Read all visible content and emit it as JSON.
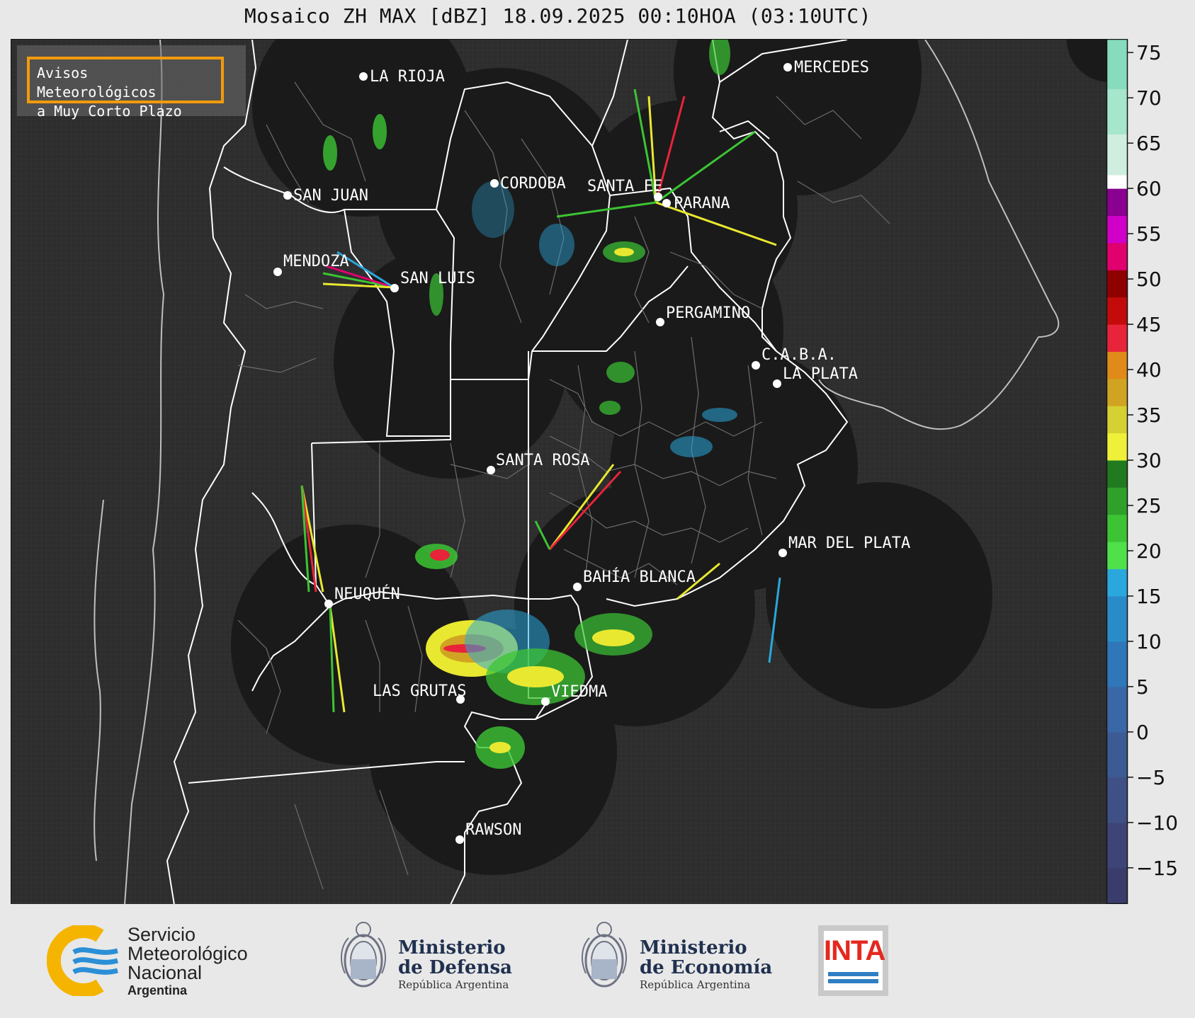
{
  "map": {
    "title": "Mosaico ZH MAX [dBZ] 18.09.2025 00:10HOA (03:10UTC)",
    "notice_line1": "Avisos Meteorológicos",
    "notice_line2": "a Muy Corto Plazo",
    "cities": [
      {
        "name": "LA RIOJA"
      },
      {
        "name": "MERCEDES"
      },
      {
        "name": "CORDOBA"
      },
      {
        "name": "SAN JUAN"
      },
      {
        "name": "SANTA FE"
      },
      {
        "name": "PARANA"
      },
      {
        "name": "MENDOZA"
      },
      {
        "name": "SAN LUIS"
      },
      {
        "name": "PERGAMINO"
      },
      {
        "name": "C.A.B.A."
      },
      {
        "name": "LA PLATA"
      },
      {
        "name": "SANTA ROSA"
      },
      {
        "name": "MAR DEL PLATA"
      },
      {
        "name": "BAHÍA BLANCA"
      },
      {
        "name": "NEUQUÉN"
      },
      {
        "name": "LAS GRUTAS"
      },
      {
        "name": "VIEDMA"
      },
      {
        "name": "RAWSON"
      }
    ]
  },
  "colorbar": {
    "unit": "dBZ",
    "min": -19,
    "max": 76.5,
    "ticks": [
      "75",
      "70",
      "65",
      "60",
      "55",
      "50",
      "45",
      "40",
      "35",
      "30",
      "25",
      "20",
      "15",
      "10",
      "5",
      "0",
      "−5",
      "−10",
      "−15"
    ],
    "tick_values": [
      75,
      70,
      65,
      60,
      55,
      50,
      45,
      40,
      35,
      30,
      25,
      20,
      15,
      10,
      5,
      0,
      -5,
      -10,
      -15
    ],
    "bands": [
      {
        "from": -19,
        "to": -15,
        "color": "#3a3d6b"
      },
      {
        "from": -15,
        "to": -10,
        "color": "#3d4578"
      },
      {
        "from": -10,
        "to": -5,
        "color": "#3e5085"
      },
      {
        "from": -5,
        "to": 0,
        "color": "#3c5b94"
      },
      {
        "from": 0,
        "to": 5,
        "color": "#3a68a6"
      },
      {
        "from": 5,
        "to": 10,
        "color": "#2f77b8"
      },
      {
        "from": 10,
        "to": 15,
        "color": "#2a8bc9"
      },
      {
        "from": 15,
        "to": 18,
        "color": "#2aa8dd"
      },
      {
        "from": 18,
        "to": 21,
        "color": "#4fe04a"
      },
      {
        "from": 21,
        "to": 24,
        "color": "#3cc434"
      },
      {
        "from": 24,
        "to": 27,
        "color": "#2fa12a"
      },
      {
        "from": 27,
        "to": 30,
        "color": "#217a20"
      },
      {
        "from": 30,
        "to": 33,
        "color": "#eef03a"
      },
      {
        "from": 33,
        "to": 36,
        "color": "#d6d132"
      },
      {
        "from": 36,
        "to": 39,
        "color": "#d0a422"
      },
      {
        "from": 39,
        "to": 42,
        "color": "#e08a1a"
      },
      {
        "from": 42,
        "to": 45,
        "color": "#e8243a"
      },
      {
        "from": 45,
        "to": 48,
        "color": "#c40b0b"
      },
      {
        "from": 48,
        "to": 51,
        "color": "#8f0000"
      },
      {
        "from": 51,
        "to": 54,
        "color": "#e0006e"
      },
      {
        "from": 54,
        "to": 57,
        "color": "#d000c8"
      },
      {
        "from": 57,
        "to": 60,
        "color": "#8a0090"
      },
      {
        "from": 60,
        "to": 61.5,
        "color": "#ffffff"
      },
      {
        "from": 61.5,
        "to": 66,
        "color": "#cfeee0"
      },
      {
        "from": 66,
        "to": 71,
        "color": "#a6e6cc"
      },
      {
        "from": 71,
        "to": 76.5,
        "color": "#86dcbc"
      }
    ]
  },
  "footer": {
    "smn_line1": "Servicio",
    "smn_line2": "Meteorológico",
    "smn_line3": "Nacional",
    "smn_country": "Argentina",
    "defensa_line1": "Ministerio",
    "defensa_line2": "de Defensa",
    "defensa_sub": "República Argentina",
    "economia_line1": "Ministerio",
    "economia_line2": "de Economía",
    "economia_sub": "República Argentina",
    "inta": "INTA"
  },
  "colors": {
    "background": "#2d2d2d",
    "radar_coverage": "#1a1a1a",
    "notice_border": "#f29b0c",
    "smn_yellow": "#f5b400",
    "smn_blue": "#2a8fd6"
  }
}
